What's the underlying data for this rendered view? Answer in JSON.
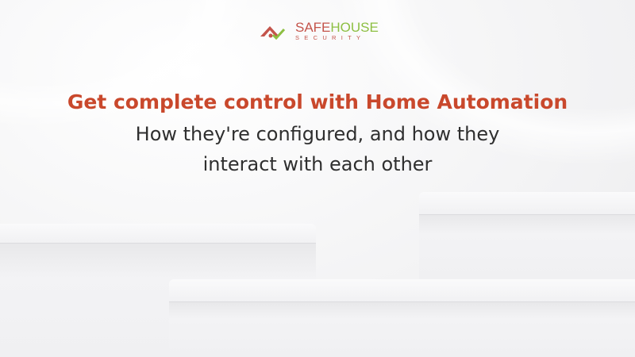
{
  "logo": {
    "word1": "SAFE",
    "word2": "HOUSE",
    "tagline": "SECURITY",
    "color_primary": "#c4544b",
    "color_accent": "#8dbf42"
  },
  "headline": "Get complete control with Home Automation",
  "subheadline": {
    "line1": "How they're configured, and how they",
    "line2": "interact with each other"
  },
  "colors": {
    "headline": "#c9482c",
    "text": "#2f2f2f"
  }
}
